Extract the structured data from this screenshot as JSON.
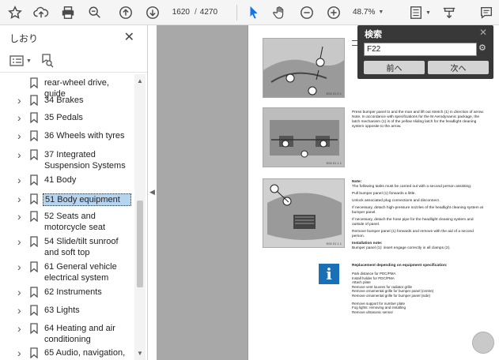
{
  "toolbar": {
    "page_current": "1620",
    "page_sep": "/",
    "page_total": "4270",
    "zoom": "48.7%",
    "icons": [
      "star-icon",
      "upload-icon",
      "print-icon",
      "zoom-search-icon",
      "page-up-icon",
      "page-down-icon",
      "pointer-icon",
      "hand-icon",
      "zoom-out-icon",
      "zoom-in-icon",
      "fit-page-icon",
      "annotation-icon",
      "comment-icon"
    ]
  },
  "sidebar": {
    "title": "しおり",
    "close": "✕",
    "items": [
      {
        "label": "rear-wheel drive, guide",
        "chev": "",
        "selected": false
      },
      {
        "label": "34 Brakes",
        "chev": ">",
        "selected": false
      },
      {
        "label": "35 Pedals",
        "chev": ">",
        "selected": false
      },
      {
        "label": "36 Wheels with tyres",
        "chev": ">",
        "selected": false
      },
      {
        "label": "37 Integrated Suspension Systems",
        "chev": ">",
        "selected": false
      },
      {
        "label": "41 Body",
        "chev": ">",
        "selected": false
      },
      {
        "label": "51 Body equipment",
        "chev": ">",
        "selected": true
      },
      {
        "label": "52 Seats and motorcycle seat",
        "chev": ">",
        "selected": false
      },
      {
        "label": "54 Slide/tilt sunroof and soft top",
        "chev": ">",
        "selected": false
      },
      {
        "label": "61 General vehicle electrical system",
        "chev": ">",
        "selected": false
      },
      {
        "label": "62 Instruments",
        "chev": ">",
        "selected": false
      },
      {
        "label": "63 Lights",
        "chev": ">",
        "selected": false
      },
      {
        "label": "64 Heating and air conditioning",
        "chev": ">",
        "selected": false
      },
      {
        "label": "65 Audio, navigation,",
        "chev": ">",
        "selected": false
      }
    ]
  },
  "page": {
    "figs": [
      {
        "code": "E00 01 0 1"
      },
      {
        "code": "E00 01 1 1"
      },
      {
        "code": "E00 01 1 1"
      }
    ],
    "text1": "Press bumper panel to and the man and lift out stretch (1) in direction of arrow. Note. In accordance with specifications for the M Aerodynamic package, the latch mechanism (1) is of the yellow sliding latch for the headlight cleaning system opposite to the arrow.",
    "note_title": "Note:",
    "note_lines": [
      "The following tasks must be carried out with a second person assisting:",
      "Pull bumper panel (1) forwards a little.",
      "Unlock associated plug connections and disconnect.",
      "If necessary, detach high-pressure nozzles of the headlight cleaning system at bumper panel.",
      "If necessary, detach the hose pipe for the headlight cleaning system and outside of panel.",
      "Remove bumper panel (1) forwards and remove with the aid of a second person.",
      "Installation note:",
      "Bumper panel (1): insert engage correctly in all clamps (2)."
    ],
    "repl_title": "Replacement depending on equipment specification:",
    "repl_items": [
      "Park distance for PDC/PMA",
      "Install holder for PDC/PMA",
      "Attach plate",
      "Remove vent louvres for radiator grille",
      "Remove ornamental grille for bumper panel (centre)",
      "Remove ornamental grille for bumper panel (side)",
      "Remove support for number plate",
      "Fog lights: removing and installing",
      "Remove ultrasonic sensor"
    ]
  },
  "search": {
    "title": "検索",
    "close": "✕",
    "value": "F22",
    "prev": "前へ",
    "next": "次へ"
  }
}
